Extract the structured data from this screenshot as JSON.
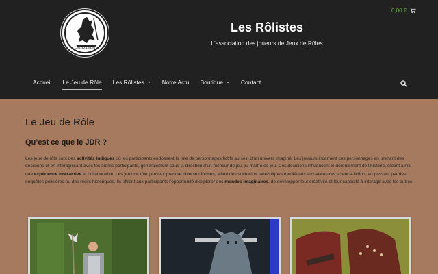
{
  "site": {
    "title": "Les Rôlistes",
    "tagline": "L'association des joueurs de Jeux de Rôles",
    "logo_text": "Les Rôlistes"
  },
  "cart": {
    "amount": "0,00 €",
    "icon": "cart-icon"
  },
  "nav": {
    "items": [
      {
        "label": "Accueil",
        "has_dropdown": false,
        "active": false
      },
      {
        "label": "Le Jeu de Rôle",
        "has_dropdown": false,
        "active": true
      },
      {
        "label": "Les Rôlistes",
        "has_dropdown": true,
        "active": false
      },
      {
        "label": "Notre Actu",
        "has_dropdown": false,
        "active": false
      },
      {
        "label": "Boutique",
        "has_dropdown": true,
        "active": false
      },
      {
        "label": "Contact",
        "has_dropdown": false,
        "active": false
      }
    ],
    "search_icon": "search-icon"
  },
  "content": {
    "page_title": "Le Jeu de Rôle",
    "subtitle": "Qu’est ce que le JDR ?",
    "para_parts": [
      "Les jeux de rôle sont des ",
      "activités ludiques",
      " où les participants endossent le rôle de personnages fictifs au sein d’un univers imaginé. Les joueurs incarnent ces personnages en prenant des décisions et en interagissant avec les autres participants, généralement sous la direction d’un meneur de jeu ou maître de jeu. Ces décisions influencent le déroulement de l’histoire, créant ainsi une ",
      "expérience interactive",
      " et collaborative. Les jeux de rôle peuvent prendre diverses formes, allant des scénarios fantastiques médiévaux aux aventures science-fiction, en passant par des enquêtes policières ou des récits historiques. Ils offrent aux participants l’opportunité d’explorer des ",
      "mondes imaginaires",
      ", de développer leur créativité et leur capacité à interagir avec les autres."
    ]
  },
  "colors": {
    "header_bg": "#212121",
    "page_bg": "#a57a5e",
    "cart_green": "#6ab04c"
  }
}
